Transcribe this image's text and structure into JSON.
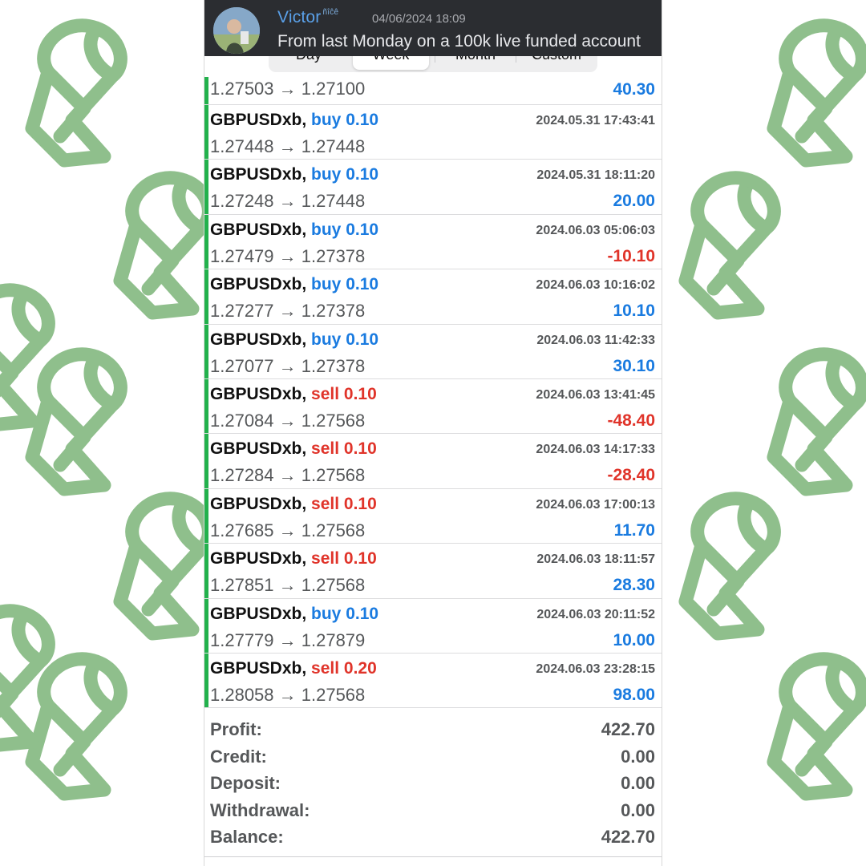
{
  "header": {
    "user_name": "Victor",
    "user_badge": "ñîĉê",
    "timestamp": "04/06/2024 18:09",
    "message": "From last Monday on a 100k live funded account"
  },
  "tabs": [
    {
      "label": "Day",
      "active": false
    },
    {
      "label": "Week",
      "active": true
    },
    {
      "label": "Month",
      "active": false
    },
    {
      "label": "Custom",
      "active": false
    }
  ],
  "partial_trade": {
    "prices": "1.27503 → 1.27100",
    "profit": "40.30"
  },
  "trades": [
    {
      "symbol": "GBPUSDxb,",
      "side": "buy",
      "volume": "0.10",
      "time": "2024.05.31 17:43:41",
      "prices": "1.27448 → 1.27448",
      "profit": "",
      "sign": "pos"
    },
    {
      "symbol": "GBPUSDxb,",
      "side": "buy",
      "volume": "0.10",
      "time": "2024.05.31 18:11:20",
      "prices": "1.27248 → 1.27448",
      "profit": "20.00",
      "sign": "pos"
    },
    {
      "symbol": "GBPUSDxb,",
      "side": "buy",
      "volume": "0.10",
      "time": "2024.06.03 05:06:03",
      "prices": "1.27479 → 1.27378",
      "profit": "-10.10",
      "sign": "neg"
    },
    {
      "symbol": "GBPUSDxb,",
      "side": "buy",
      "volume": "0.10",
      "time": "2024.06.03 10:16:02",
      "prices": "1.27277 → 1.27378",
      "profit": "10.10",
      "sign": "pos"
    },
    {
      "symbol": "GBPUSDxb,",
      "side": "buy",
      "volume": "0.10",
      "time": "2024.06.03 11:42:33",
      "prices": "1.27077 → 1.27378",
      "profit": "30.10",
      "sign": "pos"
    },
    {
      "symbol": "GBPUSDxb,",
      "side": "sell",
      "volume": "0.10",
      "time": "2024.06.03 13:41:45",
      "prices": "1.27084 → 1.27568",
      "profit": "-48.40",
      "sign": "neg"
    },
    {
      "symbol": "GBPUSDxb,",
      "side": "sell",
      "volume": "0.10",
      "time": "2024.06.03 14:17:33",
      "prices": "1.27284 → 1.27568",
      "profit": "-28.40",
      "sign": "neg"
    },
    {
      "symbol": "GBPUSDxb,",
      "side": "sell",
      "volume": "0.10",
      "time": "2024.06.03 17:00:13",
      "prices": "1.27685 → 1.27568",
      "profit": "11.70",
      "sign": "pos"
    },
    {
      "symbol": "GBPUSDxb,",
      "side": "sell",
      "volume": "0.10",
      "time": "2024.06.03 18:11:57",
      "prices": "1.27851 → 1.27568",
      "profit": "28.30",
      "sign": "pos"
    },
    {
      "symbol": "GBPUSDxb,",
      "side": "buy",
      "volume": "0.10",
      "time": "2024.06.03 20:11:52",
      "prices": "1.27779 → 1.27879",
      "profit": "10.00",
      "sign": "pos"
    },
    {
      "symbol": "GBPUSDxb,",
      "side": "sell",
      "volume": "0.20",
      "time": "2024.06.03 23:28:15",
      "prices": "1.28058 → 1.27568",
      "profit": "98.00",
      "sign": "pos"
    }
  ],
  "summary": [
    {
      "label": "Profit:",
      "value": "422.70"
    },
    {
      "label": "Credit:",
      "value": "0.00"
    },
    {
      "label": "Deposit:",
      "value": "0.00"
    },
    {
      "label": "Withdrawal:",
      "value": "0.00"
    },
    {
      "label": "Balance:",
      "value": "422.70"
    }
  ],
  "colors": {
    "buy": "#1a7be0",
    "sell": "#e0342a",
    "accent_bar": "#22b14c",
    "pattern": "#8fbf8c",
    "header_bg": "#2b2d31"
  },
  "icons": {
    "background_pattern": "brand-logo-pattern-icon",
    "avatar": "user-avatar"
  }
}
